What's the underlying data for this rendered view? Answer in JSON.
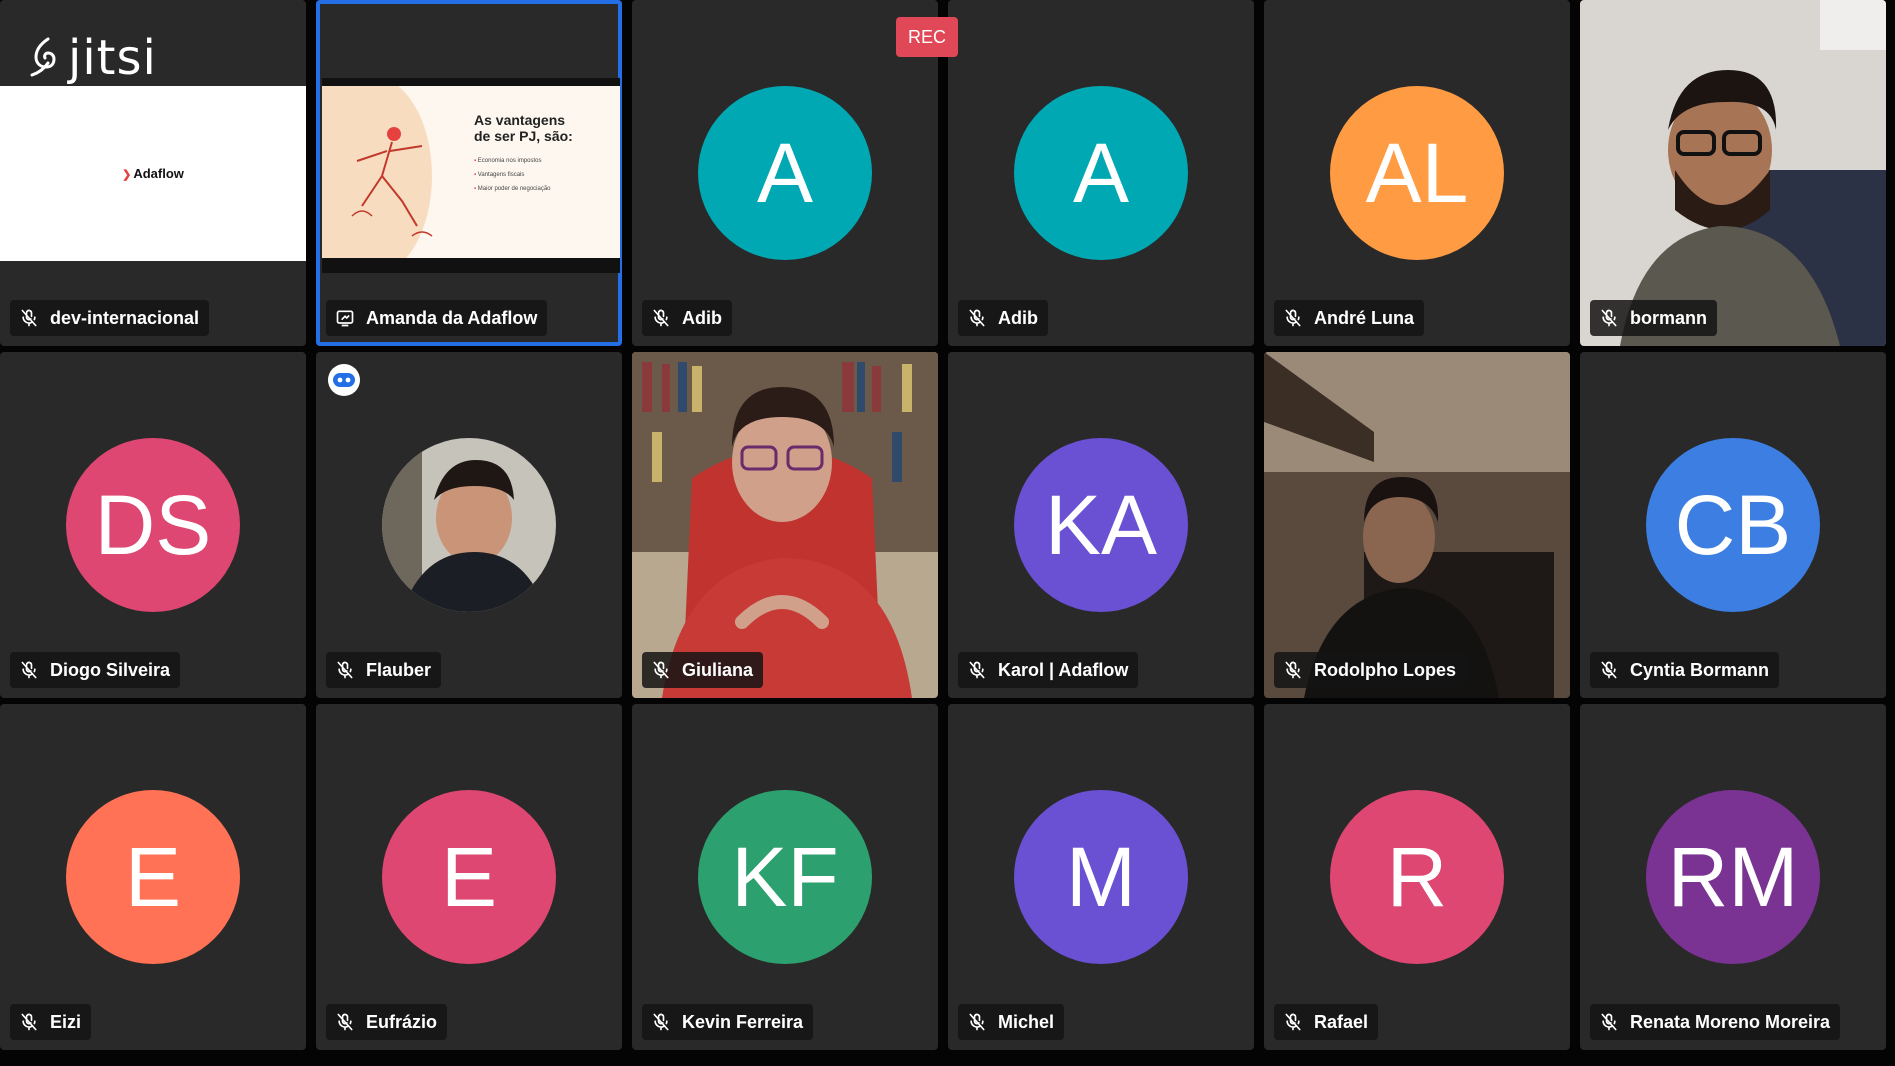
{
  "app": {
    "logo_text": "jitsi",
    "rec_label": "REC"
  },
  "share": {
    "brand": "Adaflow",
    "slide_title_1": "As vantagens",
    "slide_title_2": "de ser PJ, são:",
    "slide_lines": [
      "Economia nos impostos",
      "Vantagens fiscais",
      "Maior poder de negociação"
    ]
  },
  "colors": {
    "active_border": "#246fe5",
    "rec_bg": "#e04757",
    "tile_bg": "#292929"
  },
  "participants": [
    {
      "name": "dev-internacional",
      "icon": "mic-muted-icon"
    },
    {
      "name": "Amanda da Adaflow",
      "icon": "screenshare-icon"
    },
    {
      "name": "Adib",
      "icon": "mic-muted-icon",
      "initials": "A",
      "color": "#00a8b3"
    },
    {
      "name": "Adib",
      "icon": "mic-muted-icon",
      "initials": "A",
      "color": "#00a8b3"
    },
    {
      "name": "André Luna",
      "icon": "mic-muted-icon",
      "initials": "AL",
      "color": "#ff9b42"
    },
    {
      "name": "bormann",
      "icon": "mic-muted-icon"
    },
    {
      "name": "Diogo Silveira",
      "icon": "mic-muted-icon",
      "initials": "DS",
      "color": "#dd4771"
    },
    {
      "name": "Flauber",
      "icon": "mic-muted-icon"
    },
    {
      "name": "Giuliana",
      "icon": "mic-muted-icon"
    },
    {
      "name": "Karol | Adaflow",
      "icon": "mic-muted-icon",
      "initials": "KA",
      "color": "#6a50d3"
    },
    {
      "name": "Rodolpho Lopes",
      "icon": "mic-muted-icon"
    },
    {
      "name": "Cyntia Bormann",
      "icon": "mic-muted-icon",
      "initials": "CB",
      "color": "#3d7ee2"
    },
    {
      "name": "Eizi",
      "icon": "mic-muted-icon",
      "initials": "E",
      "color": "#ff7255"
    },
    {
      "name": "Eufrázio",
      "icon": "mic-muted-icon",
      "initials": "E",
      "color": "#dd4771"
    },
    {
      "name": "Kevin Ferreira",
      "icon": "mic-muted-icon",
      "initials": "KF",
      "color": "#2da06f"
    },
    {
      "name": "Michel",
      "icon": "mic-muted-icon",
      "initials": "M",
      "color": "#6a50d3"
    },
    {
      "name": "Rafael",
      "icon": "mic-muted-icon",
      "initials": "R",
      "color": "#dd4771"
    },
    {
      "name": "Renata Moreno Moreira",
      "icon": "mic-muted-icon",
      "initials": "RM",
      "color": "#7b3393"
    }
  ]
}
